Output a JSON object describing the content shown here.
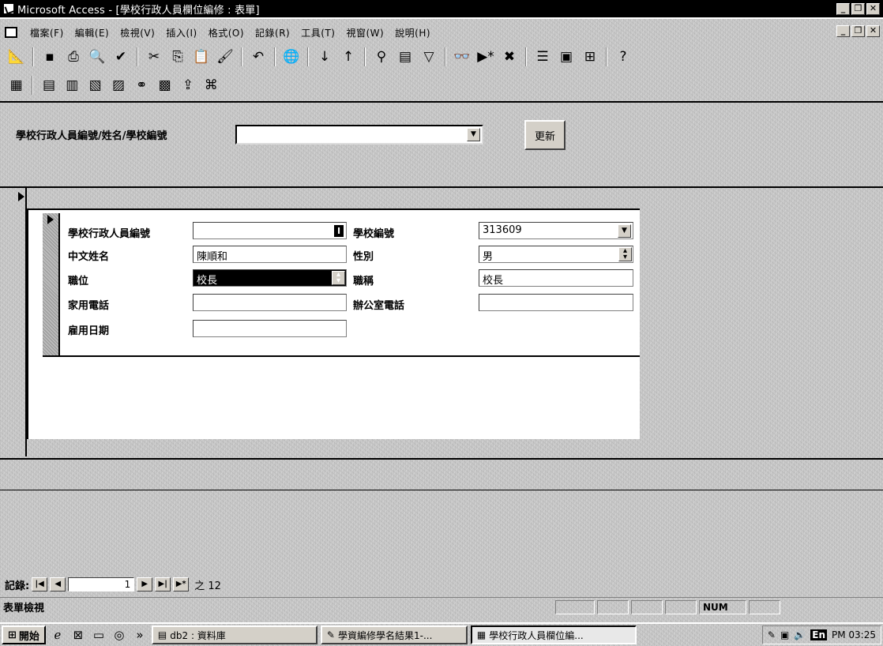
{
  "window": {
    "title": "Microsoft Access - [學校行政人員欄位編修 : 表單]",
    "min_icon": "minimize-icon",
    "max_icon": "restore-icon",
    "close_icon": "close-icon"
  },
  "menu": {
    "items": [
      "檔案(F)",
      "編輯(E)",
      "檢視(V)",
      "插入(I)",
      "格式(O)",
      "記錄(R)",
      "工具(T)",
      "視窗(W)",
      "說明(H)"
    ]
  },
  "toolbar1": {
    "icons": [
      "design-view-icon",
      "save-icon",
      "print-icon",
      "print-preview-icon",
      "spelling-icon",
      "cut-icon",
      "copy-icon",
      "paste-icon",
      "format-painter-icon",
      "undo-icon",
      "hyperlink-icon",
      "sort-ascending-icon",
      "sort-descending-icon",
      "filter-by-selection-icon",
      "filter-by-form-icon",
      "apply-filter-icon",
      "find-icon",
      "new-record-icon",
      "delete-record-icon",
      "properties-icon",
      "database-window-icon",
      "new-object-icon",
      "help-icon"
    ]
  },
  "toolbar2": {
    "icons": [
      "form-icon",
      "report-icon",
      "query-icon",
      "macro-icon",
      "module-icon",
      "relationships-icon",
      "analyze-icon",
      "publish-icon",
      "office-links-icon"
    ]
  },
  "search": {
    "label": "學校行政人員編號/姓名/學校編號",
    "value": "",
    "refresh_label": "更新"
  },
  "form": {
    "fields": {
      "staff_id": {
        "label": "學校行政人員編號",
        "value": ""
      },
      "school_id": {
        "label": "學校編號",
        "value": "313609"
      },
      "name": {
        "label": "中文姓名",
        "value": "陳順和"
      },
      "gender": {
        "label": "性別",
        "value": "男"
      },
      "position": {
        "label": "職位",
        "value": "校長"
      },
      "title": {
        "label": "職稱",
        "value": "校長"
      },
      "home_phone": {
        "label": "家用電話",
        "value": ""
      },
      "office_phone": {
        "label": "辦公室電話",
        "value": ""
      },
      "hire_date": {
        "label": "雇用日期",
        "value": ""
      }
    }
  },
  "record_nav": {
    "label": "記錄:",
    "current": "1",
    "of_label": "之 12"
  },
  "status": {
    "text": "表單檢視",
    "num": "NUM"
  },
  "taskbar": {
    "start_label": "開始",
    "overflow": "»",
    "tasks": [
      {
        "label": "db2 : 資料庫",
        "active": false
      },
      {
        "label": "學資編修學名結果1-...",
        "active": false
      },
      {
        "label": "學校行政人員欄位編...",
        "active": true
      }
    ],
    "clock": "PM 03:25",
    "ime": "En"
  }
}
